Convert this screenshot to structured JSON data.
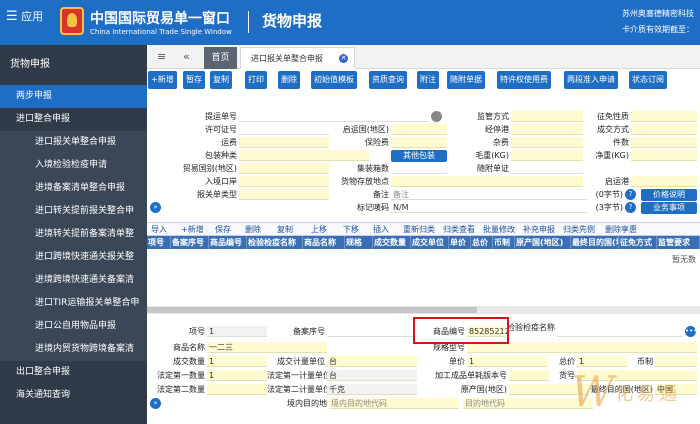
{
  "header": {
    "menu_icon": "hamburger-icon",
    "menu_label": "应用",
    "title_cn": "中国国际贸易单一窗口",
    "title_en": "China International Trade Single Window",
    "module": "货物申报",
    "company": "苏州奥塞德精密科技",
    "card_notice": "卡介质有效期截至："
  },
  "sidebar": {
    "top": "货物申报",
    "items": [
      {
        "label": "两步申报",
        "level": 0,
        "active": true
      },
      {
        "label": "进口整合申报",
        "level": 1
      },
      {
        "label": "进口报关单整合申报",
        "level": 2
      },
      {
        "label": "入境检验检疫申请",
        "level": 2
      },
      {
        "label": "进境备案清单整合申报",
        "level": 2
      },
      {
        "label": "进口转关提前报关整合申",
        "level": 2
      },
      {
        "label": "进境转关提前备案清单整",
        "level": 2
      },
      {
        "label": "进口跨境快速通关报关整",
        "level": 2
      },
      {
        "label": "进境跨境快速通关备案清",
        "level": 2
      },
      {
        "label": "进口TIR运输报关单整合申",
        "level": 2
      },
      {
        "label": "进口公自用物品申报",
        "level": 2
      },
      {
        "label": "进境内贸货物跨境备案清",
        "level": 2
      },
      {
        "label": "出口整合申报",
        "level": 1
      },
      {
        "label": "海关通知查询",
        "level": 1
      }
    ]
  },
  "tabs": {
    "home": "首页",
    "current": "进口报关单整合申报"
  },
  "toolbar": [
    "+新增",
    "暂存",
    "复制",
    "打印",
    "删除",
    "初始值模板",
    "资质查询",
    "附注",
    "随附单据",
    "特许权使用费",
    "两段准入申请",
    "状态订阅"
  ],
  "form": {
    "tiyun": "提运单号",
    "jiangguan": "监管方式",
    "zhengmian": "征免性质",
    "xuke": "许可证号",
    "qiyun": "启运国(地区)",
    "jingting": "经停港",
    "chengjiao": "成交方式",
    "yunfei": "运费",
    "baoxian": "保险费",
    "zafei": "杂费",
    "jianshu": "件数",
    "baozhuang": "包装种类",
    "qita": "其他包装",
    "maozhong": "毛重(KG)",
    "jingzhong": "净重(KG)",
    "maoyi": "贸易国别(地区)",
    "jizhuangxiang": "集装箱数",
    "suifu": "随附单证",
    "rujing": "入境口岸",
    "huowu": "货物存放地点",
    "qiyungang": "启运港",
    "baoguan": "报关单类型",
    "beizhu": "备注",
    "beizhu_ph": "备注",
    "biaoji": "标记唛码",
    "biaoji_val": "N/M",
    "char0": "(0字节)",
    "char3": "(3字节)",
    "jiage": "价格说明",
    "yewu": "业务事项"
  },
  "grid_toolbar": [
    "导入",
    "+新增",
    "保存",
    "删除",
    "复制",
    "上移",
    "下移",
    "插入",
    "重新归类",
    "归类查看",
    "批量修改",
    "补充申报",
    "归类先例",
    "删除享惠"
  ],
  "grid_headers": [
    "项号",
    "备案序号",
    "商品编号",
    "检验检疫名称",
    "商品名称",
    "规格",
    "成交数量",
    "成交单位",
    "单价",
    "总价",
    "币制",
    "原产国(地区)",
    "最终目的国(地区)",
    "征免方式",
    "监管要求"
  ],
  "grid_empty": "暂无数",
  "detail": {
    "xianghao": "项号",
    "xianghao_val": "1",
    "beian": "备案序号",
    "spbh": "商品编号",
    "spbh_val": "85285212",
    "jyjy": "检验检疫名称",
    "spmc": "商品名称",
    "spmc_val": "一二三",
    "ggxh": "规格型号",
    "cjsl": "成交数量",
    "cjsl_val": "1",
    "cjjl": "成交计量单位",
    "cjjl_val": "台",
    "dj": "单价",
    "dj_val": "1",
    "zj": "总价",
    "zj_val": "1",
    "bz": "币制",
    "fd1": "法定第一数量",
    "fd1_val": "1",
    "fdjl1": "法定第一计量单位",
    "fdjl1_val": "台",
    "jgcp": "加工成品单耗版本号",
    "hh": "货号",
    "fd2": "法定第二数量",
    "fdjl2": "法定第二计量单位",
    "fdjl2_val": "千克",
    "ycg": "原产国(地区)",
    "jnmd": "境内目的地",
    "jnmd_ph": "境内目的地代码",
    "jnmd_ph2": "目的地代码",
    "zzmd": "最终目的国(地区)",
    "zzmd_val": "中国"
  },
  "colors": {
    "header": "#1f6ec5",
    "sidebar": "#2f3b49",
    "field": "#fffbd0",
    "highlight_box": "#d8141b"
  }
}
